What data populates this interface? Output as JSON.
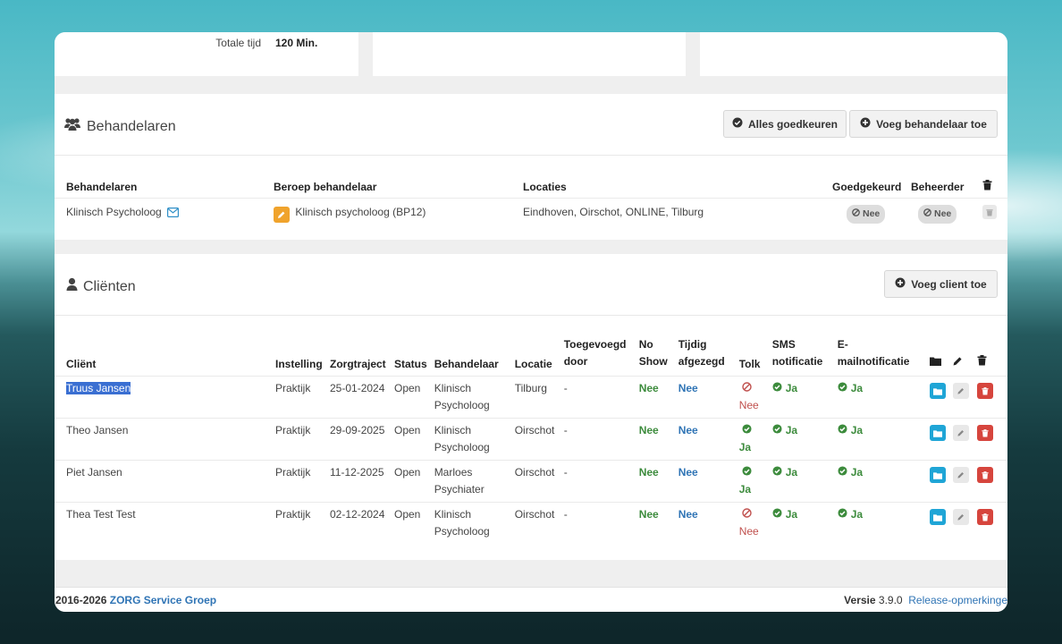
{
  "stats": {
    "total_label": "Totale tijd",
    "total_value": "120 Min."
  },
  "behandelaren_panel": {
    "title": "Behandelaren",
    "approve_all_label": "Alles goedkeuren",
    "add_label": "Voeg behandelaar toe",
    "columns": [
      "Behandelaren",
      "Beroep behandelaar",
      "Locaties",
      "Goedgekeurd",
      "Beheerder"
    ],
    "row": {
      "name": "Klinisch Psycholoog",
      "profession": "Klinisch psycholoog (BP12)",
      "locations": "Eindhoven, Oirschot, ONLINE, Tilburg",
      "approved": "Nee",
      "admin": "Nee"
    }
  },
  "clienten_panel": {
    "title": "Cliënten",
    "add_label": "Voeg client toe",
    "columns": {
      "client": "Cliënt",
      "instelling": "Instelling",
      "zorgtraject": "Zorgtraject",
      "status": "Status",
      "behandelaar": "Behandelaar",
      "locatie": "Locatie",
      "toegevoegd_1": "Toegevoegd",
      "toegevoegd_2": "door",
      "noshow_1": "No",
      "noshow_2": "Show",
      "tijdig_1": "Tijdig",
      "tijdig_2": "afgezegd",
      "tolk": "Tolk",
      "sms_1": "SMS",
      "sms_2": "notificatie",
      "email_1": "E-",
      "email_2": "mailnotificatie"
    },
    "rows": [
      {
        "client": "Truus Jansen",
        "instelling": "Praktijk",
        "zorgtraject": "25-01-2024",
        "status": "Open",
        "behandelaar_1": "Klinisch",
        "behandelaar_2": "Psycholoog",
        "locatie": "Tilburg",
        "toegevoegd": "-",
        "noshow": "Nee",
        "tijdig": "Nee",
        "tolk": "Nee",
        "sms": "Ja",
        "email": "Ja"
      },
      {
        "client": "Theo Jansen",
        "instelling": "Praktijk",
        "zorgtraject": "29-09-2025",
        "status": "Open",
        "behandelaar_1": "Klinisch",
        "behandelaar_2": "Psycholoog",
        "locatie": "Oirschot",
        "toegevoegd": "-",
        "noshow": "Nee",
        "tijdig": "Nee",
        "tolk": "Ja",
        "sms": "Ja",
        "email": "Ja"
      },
      {
        "client": "Piet Jansen",
        "instelling": "Praktijk",
        "zorgtraject": "11-12-2025",
        "status": "Open",
        "behandelaar_1": "Marloes",
        "behandelaar_2": "Psychiater",
        "locatie": "Oirschot",
        "toegevoegd": "-",
        "noshow": "Nee",
        "tijdig": "Nee",
        "tolk": "Ja",
        "sms": "Ja",
        "email": "Ja"
      },
      {
        "client": "Thea Test Test",
        "instelling": "Praktijk",
        "zorgtraject": "02-12-2024",
        "status": "Open",
        "behandelaar_1": "Klinisch",
        "behandelaar_2": "Psycholoog",
        "locatie": "Oirschot",
        "toegevoegd": "-",
        "noshow": "Nee",
        "tijdig": "Nee",
        "tolk": "Nee",
        "sms": "Ja",
        "email": "Ja"
      }
    ]
  },
  "footer": {
    "years": "2016-2026",
    "company": "ZORG Service Groep",
    "version_label": "Versie",
    "version": "3.9.0",
    "release_notes": "Release-opmerkinge"
  },
  "colors": {
    "accent_blue": "#2f74b5",
    "green": "#3c8b3c",
    "red": "#c0504d",
    "folder_blue": "#1fa5d6",
    "delete_red": "#d6453d"
  }
}
